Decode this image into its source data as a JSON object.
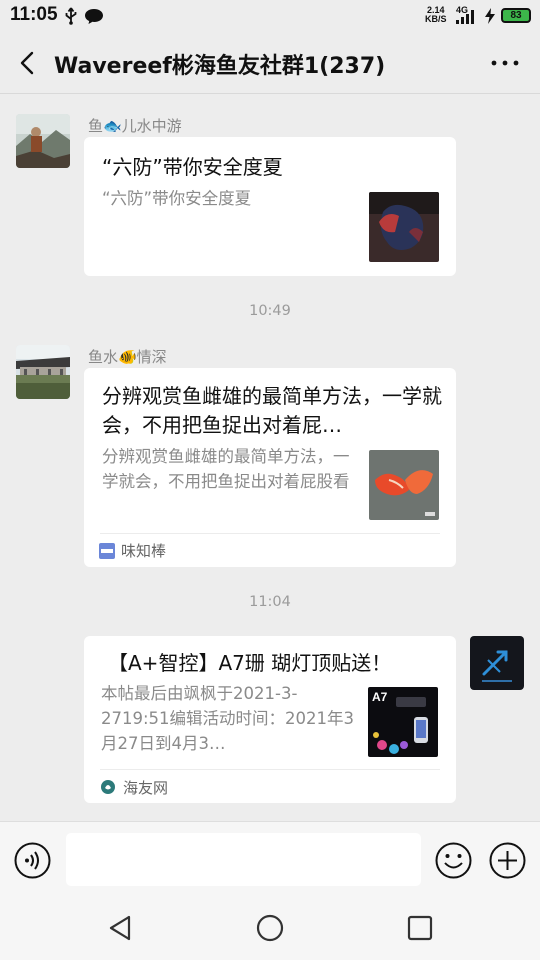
{
  "status_bar": {
    "time": "11:05",
    "net_speed_value": "2.14",
    "net_speed_unit": "KB/S",
    "network_type": "4G",
    "battery": "83"
  },
  "header": {
    "title": "Wavereef彬海鱼友社群1(237)"
  },
  "messages": [
    {
      "sender": "鱼🐟儿水中游",
      "title": "“六防”带你安全度夏",
      "desc": "“六防”带你安全度夏"
    },
    {
      "time": "10:49"
    },
    {
      "sender": "鱼水🐠情深",
      "title": "分辨观赏鱼雌雄的最简单方法，一学就会，不用把鱼捉出对着屁…",
      "desc": "分辨观赏鱼雌雄的最简单方法，一学就会，不用把鱼捉出对着屁股看",
      "source": "味知棒"
    },
    {
      "time": "11:04"
    },
    {
      "title": "【A+智控】A7珊 瑚灯顶贴送！",
      "desc": "本帖最后由飒枫于2021-3-2719:51编辑活动时间：2021年3月27日到4月3…",
      "source": "海友网",
      "thumb_label": "A7"
    }
  ],
  "colors": {
    "background": "#ededed",
    "card": "#ffffff",
    "battery": "#3cb64a"
  }
}
